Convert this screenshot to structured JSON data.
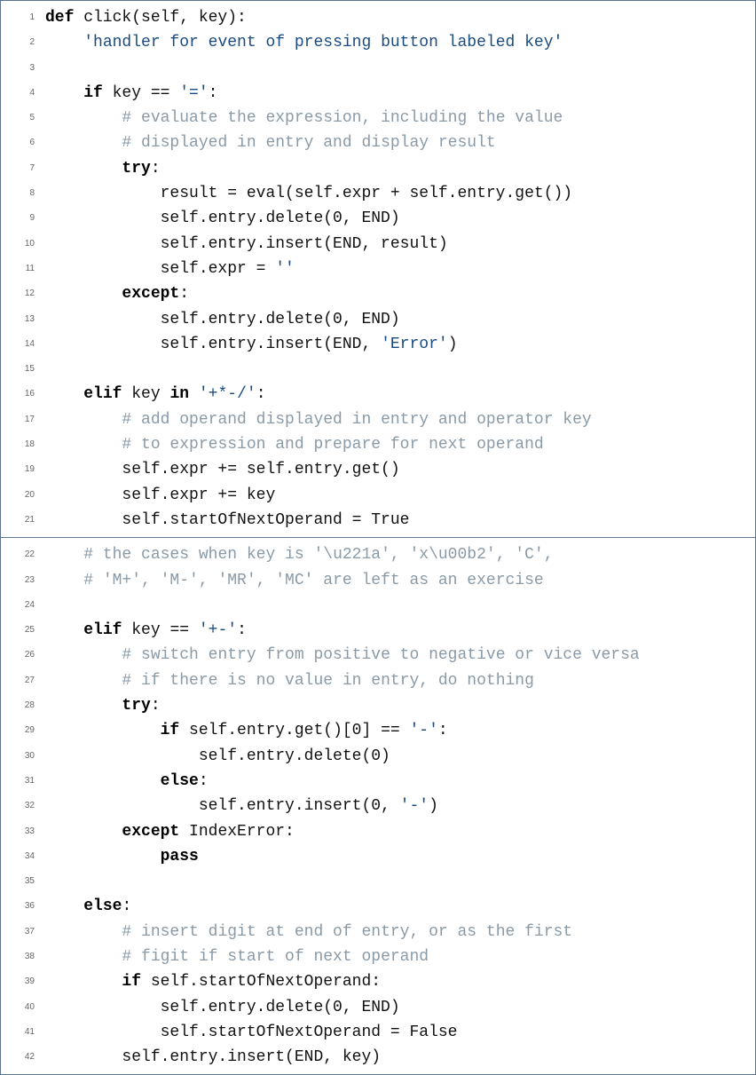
{
  "blocks": [
    {
      "startLine": 1,
      "lines": [
        [
          {
            "t": "kw",
            "v": "def"
          },
          {
            "t": "",
            "v": " click(self, key):"
          }
        ],
        [
          {
            "t": "",
            "v": "    "
          },
          {
            "t": "str",
            "v": "'handler for event of pressing button labeled key'"
          }
        ],
        [
          {
            "t": "",
            "v": ""
          }
        ],
        [
          {
            "t": "",
            "v": "    "
          },
          {
            "t": "kw",
            "v": "if"
          },
          {
            "t": "",
            "v": " key == "
          },
          {
            "t": "str",
            "v": "'='"
          },
          {
            "t": "",
            "v": ":"
          }
        ],
        [
          {
            "t": "",
            "v": "        "
          },
          {
            "t": "cm",
            "v": "# evaluate the expression, including the value"
          }
        ],
        [
          {
            "t": "",
            "v": "        "
          },
          {
            "t": "cm",
            "v": "# displayed in entry and display result"
          }
        ],
        [
          {
            "t": "",
            "v": "        "
          },
          {
            "t": "kw",
            "v": "try"
          },
          {
            "t": "",
            "v": ":"
          }
        ],
        [
          {
            "t": "",
            "v": "            result = eval(self.expr + self.entry.get())"
          }
        ],
        [
          {
            "t": "",
            "v": "            self.entry.delete(0, END)"
          }
        ],
        [
          {
            "t": "",
            "v": "            self.entry.insert(END, result)"
          }
        ],
        [
          {
            "t": "",
            "v": "            self.expr = "
          },
          {
            "t": "str",
            "v": "''"
          }
        ],
        [
          {
            "t": "",
            "v": "        "
          },
          {
            "t": "kw",
            "v": "except"
          },
          {
            "t": "",
            "v": ":"
          }
        ],
        [
          {
            "t": "",
            "v": "            self.entry.delete(0, END)"
          }
        ],
        [
          {
            "t": "",
            "v": "            self.entry.insert(END, "
          },
          {
            "t": "str",
            "v": "'Error'"
          },
          {
            "t": "",
            "v": ")"
          }
        ],
        [
          {
            "t": "",
            "v": ""
          }
        ],
        [
          {
            "t": "",
            "v": "    "
          },
          {
            "t": "kw",
            "v": "elif"
          },
          {
            "t": "",
            "v": " key "
          },
          {
            "t": "kw",
            "v": "in"
          },
          {
            "t": "",
            "v": " "
          },
          {
            "t": "str",
            "v": "'+*-/'"
          },
          {
            "t": "",
            "v": ":"
          }
        ],
        [
          {
            "t": "",
            "v": "        "
          },
          {
            "t": "cm",
            "v": "# add operand displayed in entry and operator key"
          }
        ],
        [
          {
            "t": "",
            "v": "        "
          },
          {
            "t": "cm",
            "v": "# to expression and prepare for next operand"
          }
        ],
        [
          {
            "t": "",
            "v": "        self.expr += self.entry.get()"
          }
        ],
        [
          {
            "t": "",
            "v": "        self.expr += key"
          }
        ],
        [
          {
            "t": "",
            "v": "        self.startOfNextOperand = True"
          }
        ]
      ]
    },
    {
      "startLine": 22,
      "lines": [
        [
          {
            "t": "",
            "v": "    "
          },
          {
            "t": "cm",
            "v": "# the cases when key is '\\u221a', 'x\\u00b2', 'C',"
          }
        ],
        [
          {
            "t": "",
            "v": "    "
          },
          {
            "t": "cm",
            "v": "# 'M+', 'M-', 'MR', 'MC' are left as an exercise"
          }
        ],
        [
          {
            "t": "",
            "v": ""
          }
        ],
        [
          {
            "t": "",
            "v": "    "
          },
          {
            "t": "kw",
            "v": "elif"
          },
          {
            "t": "",
            "v": " key == "
          },
          {
            "t": "str",
            "v": "'+-'"
          },
          {
            "t": "",
            "v": ":"
          }
        ],
        [
          {
            "t": "",
            "v": "        "
          },
          {
            "t": "cm",
            "v": "# switch entry from positive to negative or vice versa"
          }
        ],
        [
          {
            "t": "",
            "v": "        "
          },
          {
            "t": "cm",
            "v": "# if there is no value in entry, do nothing"
          }
        ],
        [
          {
            "t": "",
            "v": "        "
          },
          {
            "t": "kw",
            "v": "try"
          },
          {
            "t": "",
            "v": ":"
          }
        ],
        [
          {
            "t": "",
            "v": "            "
          },
          {
            "t": "kw",
            "v": "if"
          },
          {
            "t": "",
            "v": " self.entry.get()[0] == "
          },
          {
            "t": "str",
            "v": "'-'"
          },
          {
            "t": "",
            "v": ":"
          }
        ],
        [
          {
            "t": "",
            "v": "                self.entry.delete(0)"
          }
        ],
        [
          {
            "t": "",
            "v": "            "
          },
          {
            "t": "kw",
            "v": "else"
          },
          {
            "t": "",
            "v": ":"
          }
        ],
        [
          {
            "t": "",
            "v": "                self.entry.insert(0, "
          },
          {
            "t": "str",
            "v": "'-'"
          },
          {
            "t": "",
            "v": ")"
          }
        ],
        [
          {
            "t": "",
            "v": "        "
          },
          {
            "t": "kw",
            "v": "except"
          },
          {
            "t": "",
            "v": " IndexError:"
          }
        ],
        [
          {
            "t": "",
            "v": "            "
          },
          {
            "t": "kw",
            "v": "pass"
          }
        ],
        [
          {
            "t": "",
            "v": ""
          }
        ],
        [
          {
            "t": "",
            "v": "    "
          },
          {
            "t": "kw",
            "v": "else"
          },
          {
            "t": "",
            "v": ":"
          }
        ],
        [
          {
            "t": "",
            "v": "        "
          },
          {
            "t": "cm",
            "v": "# insert digit at end of entry, or as the first"
          }
        ],
        [
          {
            "t": "",
            "v": "        "
          },
          {
            "t": "cm",
            "v": "# figit if start of next operand"
          }
        ],
        [
          {
            "t": "",
            "v": "        "
          },
          {
            "t": "kw",
            "v": "if"
          },
          {
            "t": "",
            "v": " self.startOfNextOperand:"
          }
        ],
        [
          {
            "t": "",
            "v": "            self.entry.delete(0, END)"
          }
        ],
        [
          {
            "t": "",
            "v": "            self.startOfNextOperand = False"
          }
        ],
        [
          {
            "t": "",
            "v": "        self.entry.insert(END, key)"
          }
        ]
      ]
    }
  ]
}
